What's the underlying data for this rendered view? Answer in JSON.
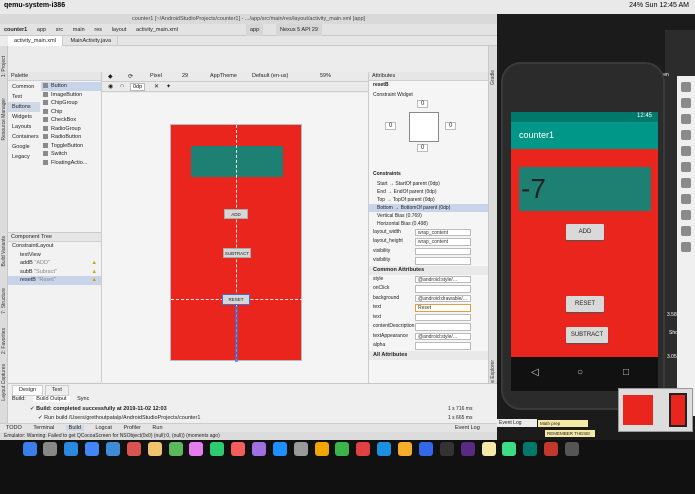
{
  "menubar": {
    "app_name": "qemu-system-i386",
    "status_right": "24%  Sun 12:45 AM"
  },
  "ide": {
    "title": "counter1 [~/AndroidStudioProjects/counter1] - .../app/src/main/res/layout/activity_main.xml [app]",
    "breadcrumbs": [
      "counter1",
      "app",
      "src",
      "main",
      "res",
      "layout",
      "activity_main.xml"
    ],
    "tabs": [
      "activity_main.xml",
      "MainActivity.java"
    ],
    "left_strip": [
      "1: Project",
      "Resource Manager",
      "7: Structure",
      "Layout Captures",
      "Build Variants",
      "2: Favorites"
    ],
    "right_strip": [
      "Gradle",
      "Device File Explorer"
    ],
    "design_toolbar": {
      "device": "Pixel",
      "api": "29",
      "theme": "AppTheme",
      "locale": "Default (en-us)",
      "zoom": "59%",
      "device_pill": "Nexus 5 API 29",
      "app_module": "app",
      "margin": "0dp"
    },
    "palette": {
      "title": "Palette",
      "categories": [
        "Common",
        "Text",
        "Buttons",
        "Widgets",
        "Layouts",
        "Containers",
        "Google",
        "Legacy"
      ],
      "selected_category": "Buttons",
      "items": [
        "Button",
        "ImageButton",
        "ChipGroup",
        "Chip",
        "CheckBox",
        "RadioGroup",
        "RadioButton",
        "ToggleButton",
        "Switch",
        "FloatingActio..."
      ]
    },
    "component_tree": {
      "title": "Component Tree",
      "items": [
        {
          "label": "ConstraintLayout",
          "sub": "",
          "warn": false
        },
        {
          "label": "textView",
          "sub": "",
          "warn": false
        },
        {
          "label": "addB",
          "sub": "\"ADD\"",
          "warn": true
        },
        {
          "label": "subB",
          "sub": "\"Subract\"",
          "warn": true
        },
        {
          "label": "resetB",
          "sub": "\"Reset\"",
          "warn": true
        }
      ]
    },
    "blueprint": {
      "add_label": "ADD",
      "subtract_label": "SUBTRACT",
      "reset_label": "RESET"
    },
    "attributes": {
      "title": "Attributes",
      "component": "resetB",
      "constraint_widget": "Constraint Widget",
      "constraint_values": [
        "0",
        "0",
        "0",
        "0"
      ],
      "constraints_title": "Constraints",
      "constraints": [
        "Start → StartOf parent (0dp)",
        "End → EndOf parent (0dp)",
        "Top → TopOf parent (0dp)",
        "Bottom → BottomOf parent (0dp)",
        "Vertical Bias (0.769)",
        "Horizontal Bias (0.498)"
      ],
      "layout_rows": [
        {
          "label": "layout_width",
          "value": "wrap_content"
        },
        {
          "label": "layout_height",
          "value": "wrap_content"
        },
        {
          "label": "visibility",
          "value": ""
        },
        {
          "label": "visibility",
          "value": ""
        }
      ],
      "common_title": "Common Attributes",
      "common_rows": [
        {
          "label": "style",
          "value": "@android:style/..."
        },
        {
          "label": "onClick",
          "value": ""
        },
        {
          "label": "background",
          "value": "@android:drawable/..."
        },
        {
          "label": "text",
          "value": "Reset"
        },
        {
          "label": "text",
          "value": ""
        },
        {
          "label": "contentDescription",
          "value": ""
        },
        {
          "label": "textAppearance",
          "value": "@android:style/..."
        },
        {
          "label": "alpha",
          "value": ""
        }
      ],
      "all_title": "All Attributes"
    },
    "bottom": {
      "design_tab": "Design",
      "text_tab": "Text",
      "build_tab": "Build:",
      "build_output": "Build Output",
      "sync": "Sync",
      "line1": "Build: completed successfully at 2019-11-02 12:03",
      "line2": "Run build /Users/grethoutpatalp/AndroidStudioProjects/counter1",
      "time1": "1 s 716 ms",
      "time2": "1 s 665 ms"
    },
    "toolwindows": [
      "TODO",
      "Terminal",
      "Build",
      "Logcat",
      "Profiler",
      "Run",
      "Event Log"
    ],
    "status": "Emulator: Warning: Failed to get QCocoaScreen for NSObject(0x0) (null):0, (null)) (moments ago)"
  },
  "emulator": {
    "time": "12:45",
    "app_title": "counter1",
    "counter_value": "-7",
    "add_label": "ADD",
    "reset_label": "RESET",
    "subtract_label": "SUBTRACT"
  },
  "desktop": {
    "screen_label_1": "Screen",
    "screen_time_1": "3.58 AM",
    "screen_label_2": "Shot",
    "screen_time_2": "3.05 AM",
    "event_log": "Event Log",
    "math_label": "Math prep",
    "remember": "REMEMBER THESE!"
  }
}
